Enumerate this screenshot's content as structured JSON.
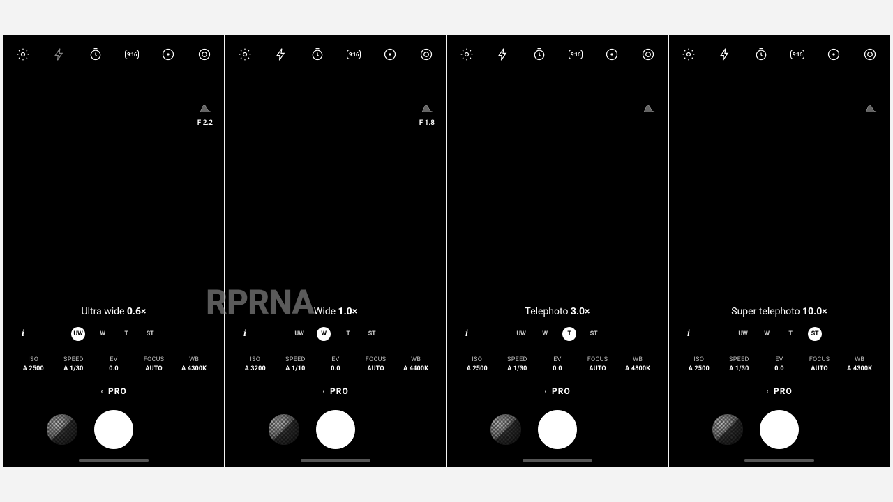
{
  "watermark": "RPRNA",
  "top_icons": {
    "aspect_label": "9:16"
  },
  "lens_buttons": [
    "UW",
    "W",
    "T",
    "ST"
  ],
  "mode_label": "PRO",
  "param_keys": {
    "iso": "ISO",
    "speed": "SPEED",
    "ev": "EV",
    "focus": "FOCUS",
    "wb": "WB"
  },
  "screens": [
    {
      "lens_name": "Ultra wide ",
      "zoom": "0.6×",
      "active_lens": "UW",
      "aperture": "F 2.2",
      "show_aperture": true,
      "flash_on": false,
      "params": {
        "iso": "A 2500",
        "speed": "A 1/30",
        "ev": "0.0",
        "focus": "AUTO",
        "wb": "A 4300K"
      }
    },
    {
      "lens_name": "Wide ",
      "zoom": "1.0×",
      "active_lens": "W",
      "aperture": "F 1.8",
      "show_aperture": true,
      "flash_on": true,
      "params": {
        "iso": "A 3200",
        "speed": "A 1/10",
        "ev": "0.0",
        "focus": "AUTO",
        "wb": "A 4400K"
      }
    },
    {
      "lens_name": "Telephoto ",
      "zoom": "3.0×",
      "active_lens": "T",
      "aperture": "",
      "show_aperture": false,
      "flash_on": true,
      "params": {
        "iso": "A 2500",
        "speed": "A 1/30",
        "ev": "0.0",
        "focus": "AUTO",
        "wb": "A 4800K"
      }
    },
    {
      "lens_name": "Super telephoto ",
      "zoom": "10.0×",
      "active_lens": "ST",
      "aperture": "",
      "show_aperture": false,
      "flash_on": true,
      "params": {
        "iso": "A 2500",
        "speed": "A 1/30",
        "ev": "0.0",
        "focus": "AUTO",
        "wb": "A 4300K"
      }
    }
  ]
}
